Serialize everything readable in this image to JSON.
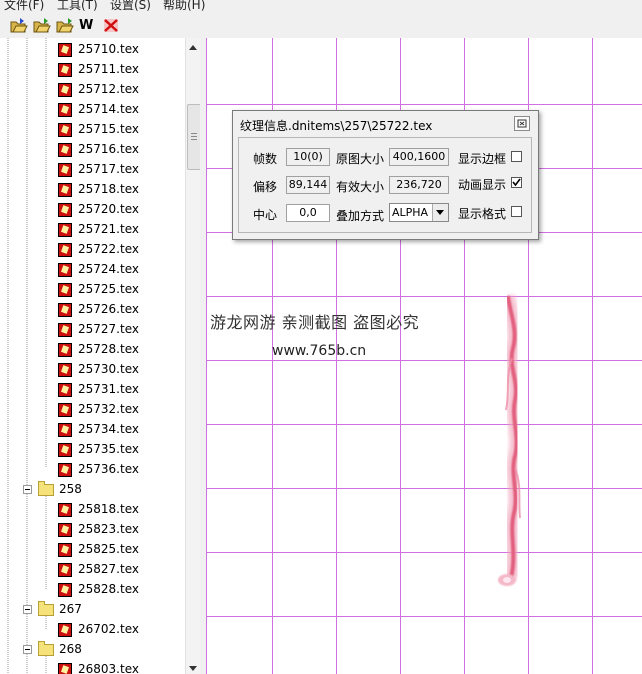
{
  "menu": [
    "文件(F)",
    "工具(T)",
    "设置(S)",
    "帮助(H)"
  ],
  "toolbar": {
    "w_label": "W"
  },
  "tree": {
    "rows": [
      {
        "type": "tex",
        "label": "25710.tex"
      },
      {
        "type": "tex",
        "label": "25711.tex"
      },
      {
        "type": "tex",
        "label": "25712.tex"
      },
      {
        "type": "tex",
        "label": "25714.tex"
      },
      {
        "type": "tex",
        "label": "25715.tex"
      },
      {
        "type": "tex",
        "label": "25716.tex"
      },
      {
        "type": "tex",
        "label": "25717.tex"
      },
      {
        "type": "tex",
        "label": "25718.tex"
      },
      {
        "type": "tex",
        "label": "25720.tex"
      },
      {
        "type": "tex",
        "label": "25721.tex"
      },
      {
        "type": "tex",
        "label": "25722.tex"
      },
      {
        "type": "tex",
        "label": "25724.tex"
      },
      {
        "type": "tex",
        "label": "25725.tex"
      },
      {
        "type": "tex",
        "label": "25726.tex"
      },
      {
        "type": "tex",
        "label": "25727.tex"
      },
      {
        "type": "tex",
        "label": "25728.tex"
      },
      {
        "type": "tex",
        "label": "25730.tex"
      },
      {
        "type": "tex",
        "label": "25731.tex"
      },
      {
        "type": "tex",
        "label": "25732.tex"
      },
      {
        "type": "tex",
        "label": "25734.tex"
      },
      {
        "type": "tex",
        "label": "25735.tex"
      },
      {
        "type": "tex",
        "label": "25736.tex"
      },
      {
        "type": "folder",
        "label": "258"
      },
      {
        "type": "tex",
        "label": "25818.tex"
      },
      {
        "type": "tex",
        "label": "25823.tex"
      },
      {
        "type": "tex",
        "label": "25825.tex"
      },
      {
        "type": "tex",
        "label": "25827.tex"
      },
      {
        "type": "tex",
        "label": "25828.tex"
      },
      {
        "type": "folder",
        "label": "267"
      },
      {
        "type": "tex",
        "label": "26702.tex"
      },
      {
        "type": "folder",
        "label": "268"
      },
      {
        "type": "tex",
        "label": "26803.tex"
      }
    ]
  },
  "dialog": {
    "title": "纹理信息.dnitems\\257\\25722.tex",
    "frames_label": "帧数",
    "frames_value": "10(0)",
    "orig_size_label": "原图大小",
    "orig_size_value": "400,1600",
    "show_border_label": "显示边框",
    "offset_label": "偏移",
    "offset_value": "89,144",
    "valid_size_label": "有效大小",
    "valid_size_value": "236,720",
    "animate_label": "动画显示",
    "center_label": "中心",
    "center_value": "0,0",
    "blend_label": "叠加方式",
    "blend_value": "ALPHA",
    "show_grid_label": "显示格式",
    "show_border_checked": false,
    "animate_checked": true,
    "show_grid_checked": false
  },
  "watermark": {
    "line1": "游龙网游 亲测截图 盗图必究",
    "line2": "www.765b.cn"
  },
  "colors": {
    "grid": "#d070e0",
    "effect": "#e8607a"
  }
}
